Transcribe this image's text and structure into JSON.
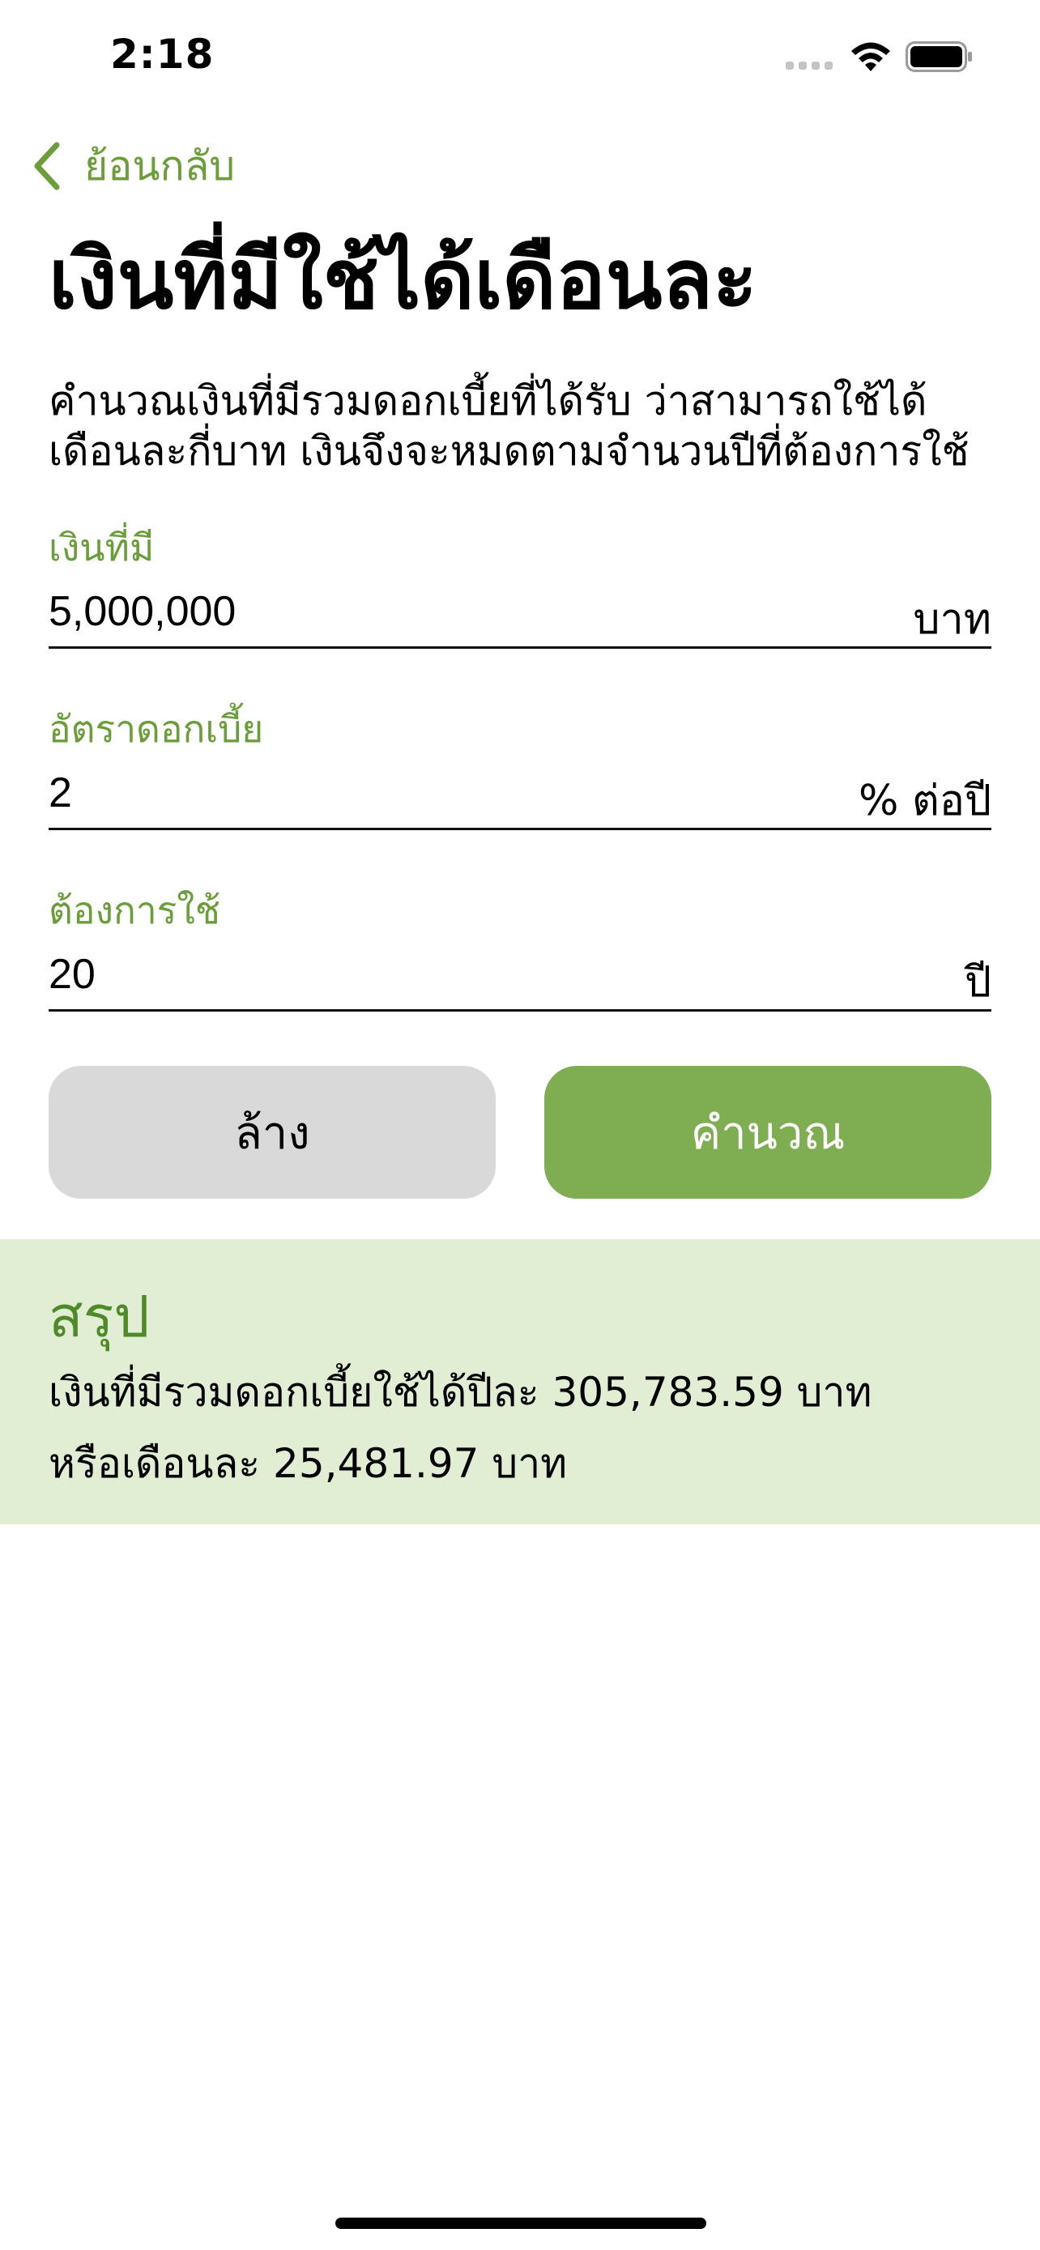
{
  "status_bar": {
    "time": "2:18"
  },
  "nav": {
    "back_label": "ย้อนกลับ"
  },
  "page": {
    "title": "เงินที่มีใช้ได้เดือนละ",
    "description": "คำนวณเงินที่มีรวมดอกเบี้ยที่ได้รับ ว่าสามารถใช้ได้เดือนละกี่บาท เงินจึงจะหมดตามจำนวนปีที่ต้องการใช้"
  },
  "form": {
    "savings": {
      "label": "เงินที่มี",
      "value": "5,000,000",
      "unit": "บาท"
    },
    "interest": {
      "label": "อัตราดอกเบี้ย",
      "value": "2",
      "unit": "% ต่อปี"
    },
    "years": {
      "label": "ต้องการใช้",
      "value": "20",
      "unit": "ปี"
    }
  },
  "buttons": {
    "clear_label": "ล้าง",
    "calculate_label": "คำนวณ"
  },
  "summary": {
    "title": "สรุป",
    "line1": "เงินที่มีรวมดอกเบี้ยใช้ได้ปีละ 305,783.59 บาท",
    "line2": "หรือเดือนละ 25,481.97 บาท"
  },
  "colors": {
    "accent": "#6b9e3a",
    "button_primary": "#7fae52",
    "button_secondary": "#d9d9d9",
    "summary_background": "#e1eed3"
  },
  "icons": {
    "signal": "cellular-signal-icon",
    "wifi": "wifi-icon",
    "battery": "battery-icon",
    "back": "chevron-left-icon"
  }
}
